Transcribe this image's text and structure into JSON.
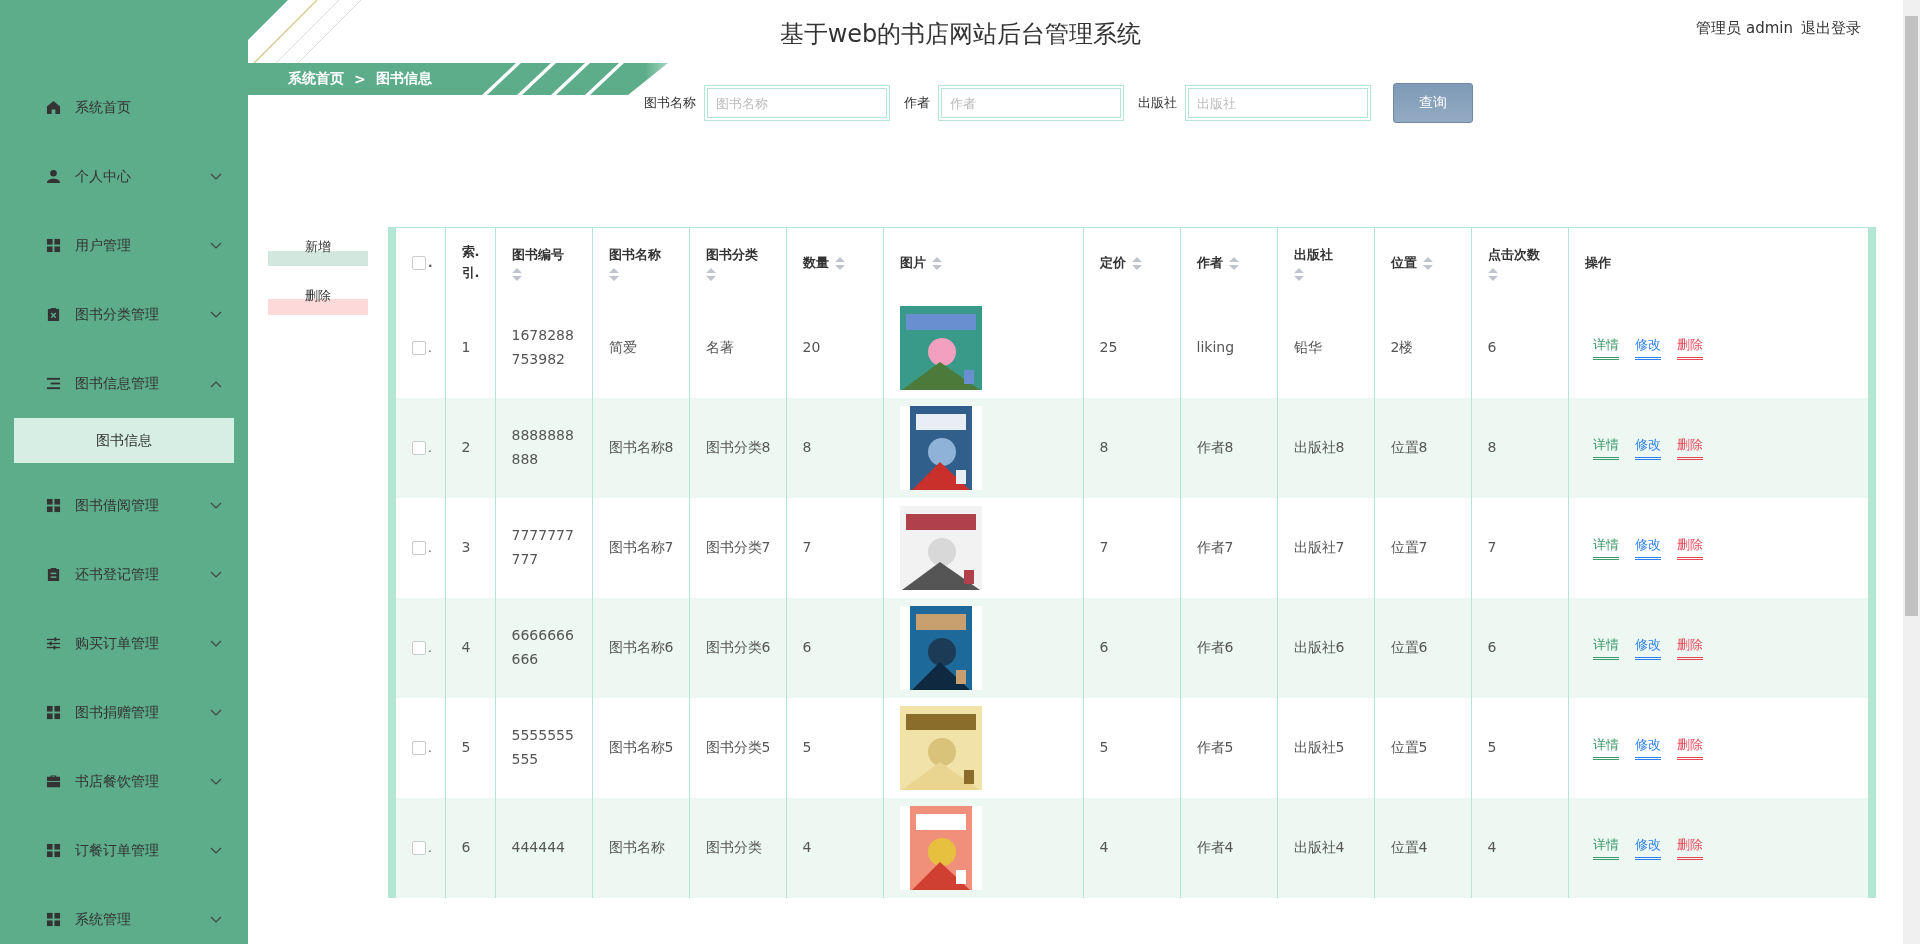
{
  "sidebar": {
    "items": [
      {
        "label": "系统首页"
      },
      {
        "label": "个人中心",
        "expanded": false
      },
      {
        "label": "用户管理",
        "expanded": false
      },
      {
        "label": "图书分类管理",
        "expanded": false
      },
      {
        "label": "图书信息管理",
        "expanded": true,
        "children": [
          {
            "label": "图书信息",
            "selected": true
          }
        ]
      },
      {
        "label": "图书借阅管理",
        "expanded": false
      },
      {
        "label": "还书登记管理",
        "expanded": false
      },
      {
        "label": "购买订单管理",
        "expanded": false
      },
      {
        "label": "图书捐赠管理",
        "expanded": false
      },
      {
        "label": "书店餐饮管理",
        "expanded": false
      },
      {
        "label": "订餐订单管理",
        "expanded": false
      },
      {
        "label": "系统管理",
        "expanded": false
      }
    ]
  },
  "header": {
    "title": "基于web的书店网站后台管理系统",
    "user": "管理员 admin",
    "logout": "退出登录"
  },
  "breadcrumb": [
    "系统首页",
    ">",
    "图书信息"
  ],
  "search": {
    "fields": [
      {
        "label": "图书名称",
        "placeholder": "图书名称"
      },
      {
        "label": "作者",
        "placeholder": "作者"
      },
      {
        "label": "出版社",
        "placeholder": "出版社"
      }
    ],
    "button": "查询"
  },
  "toolbar": [
    {
      "label": "新增",
      "kind": "add"
    },
    {
      "label": "删除",
      "kind": "delete"
    }
  ],
  "table": {
    "select_all": {
      "checked": false,
      "label": "."
    },
    "columns": [
      {
        "label": "索.引.",
        "sortable": false
      },
      {
        "label": "图书编号",
        "sortable": true
      },
      {
        "label": "图书名称",
        "sortable": true
      },
      {
        "label": "图书分类",
        "sortable": true
      },
      {
        "label": "数量",
        "sortable": true
      },
      {
        "label": "图片",
        "sortable": true
      },
      {
        "label": "定价",
        "sortable": true
      },
      {
        "label": "作者",
        "sortable": true
      },
      {
        "label": "出版社",
        "sortable": true
      },
      {
        "label": "位置",
        "sortable": true
      },
      {
        "label": "点击次数",
        "sortable": true
      },
      {
        "label": "操作",
        "sortable": false
      }
    ],
    "rows": [
      {
        "checked": false,
        "mark": ".",
        "cells": [
          "1",
          "1678288753982",
          "简爱",
          "名著",
          "20",
          null,
          "25",
          "liking",
          "铅华",
          "2楼",
          "6"
        ],
        "actions": [
          {
            "label": "详情",
            "kind": "detail"
          },
          {
            "label": "修改",
            "kind": "edit"
          },
          {
            "label": "删除",
            "kind": "delete"
          }
        ]
      },
      {
        "checked": false,
        "mark": ".",
        "cells": [
          "2",
          "8888888888",
          "图书名称8",
          "图书分类8",
          "8",
          null,
          "8",
          "作者8",
          "出版社8",
          "位置8",
          "8"
        ],
        "actions": [
          {
            "label": "详情",
            "kind": "detail"
          },
          {
            "label": "修改",
            "kind": "edit"
          },
          {
            "label": "删除",
            "kind": "delete"
          }
        ]
      },
      {
        "checked": false,
        "mark": ".",
        "cells": [
          "3",
          "7777777777",
          "图书名称7",
          "图书分类7",
          "7",
          null,
          "7",
          "作者7",
          "出版社7",
          "位置7",
          "7"
        ],
        "actions": [
          {
            "label": "详情",
            "kind": "detail"
          },
          {
            "label": "修改",
            "kind": "edit"
          },
          {
            "label": "删除",
            "kind": "delete"
          }
        ]
      },
      {
        "checked": false,
        "mark": ".",
        "cells": [
          "4",
          "6666666666",
          "图书名称6",
          "图书分类6",
          "6",
          null,
          "6",
          "作者6",
          "出版社6",
          "位置6",
          "6"
        ],
        "actions": [
          {
            "label": "详情",
            "kind": "detail"
          },
          {
            "label": "修改",
            "kind": "edit"
          },
          {
            "label": "删除",
            "kind": "delete"
          }
        ]
      },
      {
        "checked": false,
        "mark": ".",
        "cells": [
          "5",
          "5555555555",
          "图书名称5",
          "图书分类5",
          "5",
          null,
          "5",
          "作者5",
          "出版社5",
          "位置5",
          "5"
        ],
        "actions": [
          {
            "label": "详情",
            "kind": "detail"
          },
          {
            "label": "修改",
            "kind": "edit"
          },
          {
            "label": "删除",
            "kind": "delete"
          }
        ]
      },
      {
        "checked": false,
        "mark": ".",
        "cells": [
          "6",
          "444444",
          "图书名称",
          "图书分类",
          "4",
          null,
          "4",
          "作者4",
          "出版社4",
          "位置4",
          "4"
        ],
        "actions": [
          {
            "label": "详情",
            "kind": "detail"
          },
          {
            "label": "修改",
            "kind": "edit"
          },
          {
            "label": "删除",
            "kind": "delete"
          }
        ]
      }
    ]
  }
}
